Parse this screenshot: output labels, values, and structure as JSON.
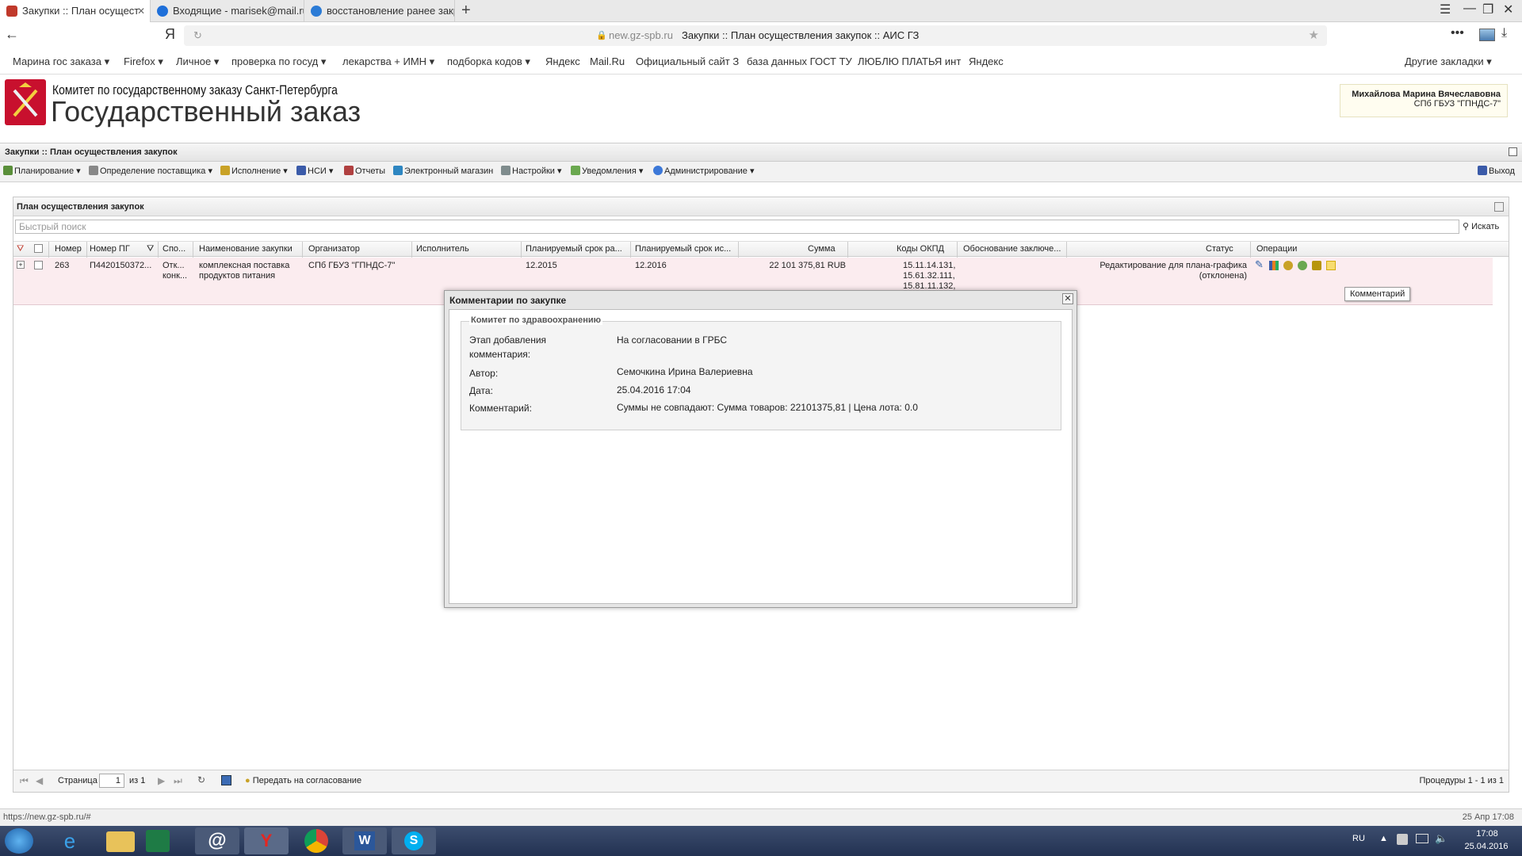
{
  "browser": {
    "tabs": [
      {
        "label": "Закупки :: План осущест",
        "color": "#c0392b"
      },
      {
        "label": "Входящие - marisek@mail.ru",
        "color": "#1e6fd9"
      },
      {
        "label": "восстановление ранее закры",
        "color": "#2b7bd6"
      }
    ],
    "url_domain": "new.gz-spb.ru",
    "url_title": "Закупки :: План осуществления закупок :: АИС ГЗ",
    "yandex_logo": "Я",
    "bookmarks": [
      "Марина гос заказа ▾",
      "Firefox ▾",
      "Личное ▾",
      "проверка по госуд ▾",
      "лекарства + ИМН ▾",
      "подборка кодов ▾",
      "Яндекс",
      "Mail.Ru",
      "Официальный сайт З",
      "база данных ГОСТ ТУ",
      "ЛЮБЛЮ ПЛАТЬЯ инт",
      "Яндекс"
    ],
    "other_bookmarks": "Другие закладки ▾"
  },
  "header": {
    "org_line": "Комитет по государственному заказу Санкт-Петербурга",
    "app_name": "Государственный заказ",
    "user_name": "Михайлова Марина Вячеславовна",
    "user_org": "СПб ГБУЗ \"ГПНДС-7\""
  },
  "breadcrumb": "Закупки :: План осуществления закупок",
  "menu": {
    "items": [
      "Планирование ▾",
      "Определение поставщика ▾",
      "Исполнение ▾",
      "НСИ ▾",
      "Отчеты",
      "Электронный магазин",
      "Настройки ▾",
      "Уведомления ▾",
      "Администрирование ▾"
    ],
    "exit": "Выход"
  },
  "panel": {
    "title": "План осуществления закупок",
    "search_placeholder": "Быстрый поиск",
    "search_button": "Искать",
    "columns": [
      "Номер",
      "Номер ПГ",
      "Спо...",
      "Наименование закупки",
      "Организатор",
      "Исполнитель",
      "Планируемый срок ра...",
      "Планируемый срок ис...",
      "Сумма",
      "Коды ОКПД",
      "Обоснование заключе...",
      "Статус",
      "Операции"
    ],
    "row": {
      "number": "263",
      "pg_number": "П4420150372...",
      "method": "Отк... конк...",
      "name": "комплексная поставка продуктов питания",
      "organizer": "СПб ГБУЗ \"ГПНДС-7\"",
      "executor": "",
      "plan_start": "12.2015",
      "plan_end": "12.2016",
      "sum": "22 101 375,81 RUB",
      "okpd": "15.11.14.131, 15.61.32.111, 15.81.11.132,",
      "basis": "",
      "status": "Редактирование для плана-графика (отклонена)"
    },
    "tooltip": "Комментарий",
    "pager": {
      "page_label": "Страница",
      "page_value": "1",
      "of_label": "из 1",
      "send_button": "Передать на согласование",
      "summary": "Процедуры 1 - 1 из 1"
    }
  },
  "dialog": {
    "title": "Комментарии по закупке",
    "group": "Комитет по здравоохранению",
    "fields": [
      {
        "label": "Этап добавления комментария:",
        "value": "На согласовании в ГРБС"
      },
      {
        "label": "Автор:",
        "value": "Семочкина Ирина Валериевна"
      },
      {
        "label": "Дата:",
        "value": "25.04.2016 17:04"
      },
      {
        "label": "Комментарий:",
        "value": "Суммы не совпадают: Сумма товаров: 22101375,81 | Цена лота: 0.0"
      }
    ]
  },
  "status": {
    "url": "https://new.gz-spb.ru/#",
    "datetime": "25 Апр 17:08"
  },
  "taskbar": {
    "lang": "RU",
    "time": "17:08",
    "date": "25.04.2016"
  }
}
